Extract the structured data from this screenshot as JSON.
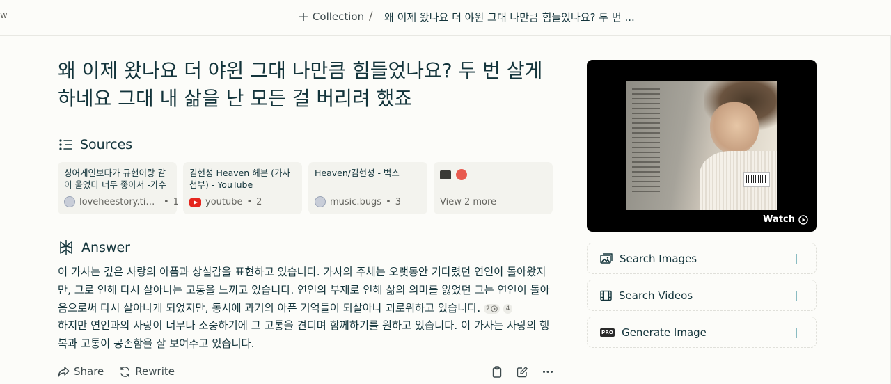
{
  "topbar": {
    "edge_text": "w",
    "collection_label": "Collection",
    "separator": "/",
    "thread_title": "왜 이제 왔나요 더 야윈 그대 나만큼 힘들었나요? 두 번 ..."
  },
  "question": "왜 이제 왔나요 더 야윈 그대 나만큼 힘들었나요? 두 번 살게 하네요 그대 내 삶을 난 모든 걸 버리려 했죠",
  "sources": {
    "heading": "Sources",
    "items": [
      {
        "title": "싱어게인보다가 규현이랑 같이 울었다 너무 좋아서 -가수 김...",
        "site": "loveheestory.tisto...",
        "index": "1",
        "icon": "globe-favicon"
      },
      {
        "title": "김현성 Heaven 헤븐 (가사 첨부) - YouTube",
        "site": "youtube",
        "index": "2",
        "icon": "youtube-icon"
      },
      {
        "title": "Heaven/김현성 - 벅스",
        "site": "music.bugs",
        "index": "3",
        "icon": "globe-favicon"
      }
    ],
    "more_label": "View 2 more"
  },
  "answer": {
    "heading": "Answer",
    "part1": "이 가사는 깊은 사랑의 아픔과 상실감을 표현하고 있습니다. 가사의 주체는 오랫동안 기다렸던 연인이 돌아왔지만, 그로 인해 다시 살아나는 고통을 느끼고 있습니다. 연인의 부재로 인해 삶의 의미를 잃었던 그는 연인이 돌아옴으로써 다시 살아나게 되었지만, 동시에 과거의 아픈 기억들이 되살아나 괴로워하고 있습니다.",
    "cite_a": "2",
    "cite_b": "4",
    "part2": "하지만 연인과의 사랑이 너무나 소중하기에 그 고통을 견디며 함께하기를 원하고 있습니다. 이 가사는 사랑의 행복과 고통이 공존함을 잘 보여주고 있습니다."
  },
  "actions": {
    "share": "Share",
    "rewrite": "Rewrite"
  },
  "video": {
    "watch_label": "Watch"
  },
  "tools": [
    {
      "label": "Search Images",
      "icon": "image-icon"
    },
    {
      "label": "Search Videos",
      "icon": "film-icon"
    },
    {
      "label": "Generate Image",
      "icon": "pro-badge",
      "badge": "PRO"
    }
  ],
  "colors": {
    "background": "#fcfcf9",
    "text": "#13343b",
    "muted": "#64645f",
    "accent": "#208090",
    "card": "#f3f3ee"
  }
}
